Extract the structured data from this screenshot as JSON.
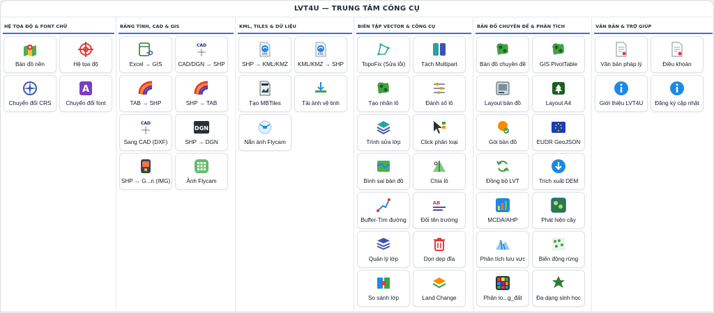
{
  "title": "LVT4U — TRUNG TÂM CÔNG CỤ",
  "columns": [
    {
      "title": "HỆ TỌA ĐỘ & FONT CHỮ",
      "tiles": [
        {
          "label": "Bản đồ nền",
          "icon": "map-pin-icon"
        },
        {
          "label": "Hệ tọa độ",
          "icon": "crosshair-icon"
        },
        {
          "label": "Chuyển đổi CRS",
          "icon": "compass-icon"
        },
        {
          "label": "Chuyển đổi font",
          "icon": "font-icon"
        }
      ]
    },
    {
      "title": "BẢNG TÍNH, CAD & GIS",
      "tiles": [
        {
          "label": "Excel → GIS",
          "icon": "excel-icon"
        },
        {
          "label": "CAD/DGN → SHP",
          "icon": "cad-icon"
        },
        {
          "label": "TAB → SHP",
          "icon": "rainbow-icon"
        },
        {
          "label": "SHP → TAB",
          "icon": "rainbow-icon"
        },
        {
          "label": "Sang CAD (DXF)",
          "icon": "cad-icon"
        },
        {
          "label": "SHP → DGN",
          "icon": "dgn-icon"
        },
        {
          "label": "SHP → G...n (IMG)",
          "icon": "gps-device-icon"
        },
        {
          "label": "Ảnh Flycam",
          "icon": "grid-icon"
        }
      ]
    },
    {
      "title": "KML, TILES & DỮ LIỆU",
      "tiles": [
        {
          "label": "SHP → KML/KMZ",
          "icon": "kml-file-icon"
        },
        {
          "label": "KML/KMZ → SHP",
          "icon": "kml-file-icon"
        },
        {
          "label": "Tạo MBTiles",
          "icon": "mbtiles-icon"
        },
        {
          "label": "Tải ảnh vệ tinh",
          "icon": "download-layer-icon"
        },
        {
          "label": "Nắn ảnh Flycam",
          "icon": "drone-icon"
        }
      ]
    },
    {
      "title": "BIÊN TẬP VECTOR & CÔNG CỤ",
      "tiles": [
        {
          "label": "TopoFix (Sửa lỗi)",
          "icon": "polygon-icon"
        },
        {
          "label": "Tách Multipart",
          "icon": "split-icon"
        },
        {
          "label": "Tạo nhãn lô",
          "icon": "map-green-icon"
        },
        {
          "label": "Đánh số lô",
          "icon": "sliders-icon"
        },
        {
          "label": "Trình sửa lớp",
          "icon": "layers-edit-icon"
        },
        {
          "label": "Click phân loại",
          "icon": "cursor-icon"
        },
        {
          "label": "Bình sai bản đồ",
          "icon": "adjust-map-icon"
        },
        {
          "label": "Chia lô",
          "icon": "split-area-icon"
        },
        {
          "label": "Buffer-Tìm đường",
          "icon": "route-icon"
        },
        {
          "label": "Đổi tên trường",
          "icon": "rename-icon"
        },
        {
          "label": "Quản lý lớp",
          "icon": "stack-icon"
        },
        {
          "label": "Dọn dẹp đĩa",
          "icon": "trash-icon"
        },
        {
          "label": "So sánh lớp",
          "icon": "compare-icon"
        },
        {
          "label": "Land Change",
          "icon": "land-layers-icon"
        }
      ]
    },
    {
      "title": "BẢN ĐỒ CHUYÊN ĐỀ & PHÂN TÍCH",
      "tiles": [
        {
          "label": "Bản đồ chuyên đề",
          "icon": "map-green-icon"
        },
        {
          "label": "GIS PivotTable",
          "icon": "map-green-icon"
        },
        {
          "label": "Layout bản đồ",
          "icon": "layout-icon"
        },
        {
          "label": "Layout A4",
          "icon": "tree-icon"
        },
        {
          "label": "Gói bản đồ",
          "icon": "package-icon"
        },
        {
          "label": "EUDR GeoJSON",
          "icon": "eu-flag-icon"
        },
        {
          "label": "Đồng bộ LVT",
          "icon": "sync-icon"
        },
        {
          "label": "Trích xuất DEM",
          "icon": "download-circle-icon"
        },
        {
          "label": "MCDA/AHP",
          "icon": "chart-icon"
        },
        {
          "label": "Phát hiện cây",
          "icon": "tree-detect-icon"
        },
        {
          "label": "Phân tích lưu vực",
          "icon": "watershed-icon"
        },
        {
          "label": "Biến động rừng",
          "icon": "forest-change-icon"
        },
        {
          "label": "Phân lo...g_đất",
          "icon": "color-grid-icon"
        },
        {
          "label": "Đa dạng sinh học",
          "icon": "leaf-icon"
        }
      ]
    },
    {
      "title": "VĂN BẢN & TRỢ GIÚP",
      "tiles": [
        {
          "label": "Văn bản pháp lý",
          "icon": "document-icon"
        },
        {
          "label": "Điều khoản",
          "icon": "document-icon"
        },
        {
          "label": "Giới thiệu LVT4U",
          "icon": "info-icon"
        },
        {
          "label": "Đăng ký cập nhật",
          "icon": "info-icon"
        }
      ]
    }
  ]
}
